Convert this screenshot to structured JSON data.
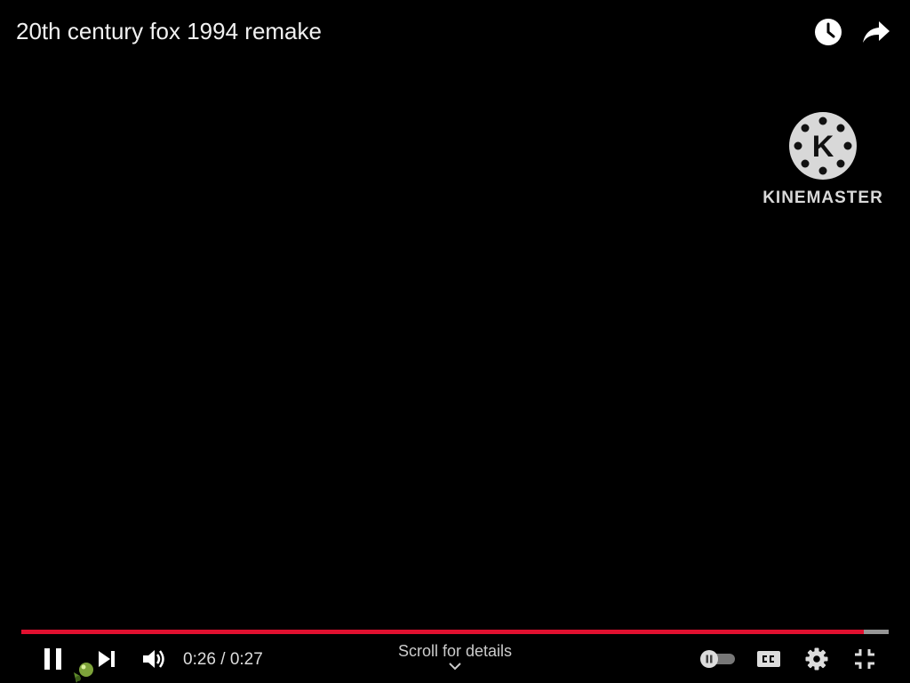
{
  "video": {
    "title": "20th century fox 1994 remake",
    "current_time": "0:26",
    "duration": "0:27",
    "time_separator": " / ",
    "progress_fraction": 0.971
  },
  "watermark": {
    "text": "KINEMASTER",
    "logo_letter": "K"
  },
  "hint": {
    "scroll": "Scroll for details"
  },
  "icons": {
    "watch_later": "clock-icon",
    "share": "share-arrow-icon",
    "play_pause": "pause-icon",
    "next": "next-icon",
    "volume": "volume-icon",
    "autoplay": "autoplay-toggle-icon",
    "captions": "cc-icon",
    "settings": "gear-icon",
    "fullscreen": "exit-fullscreen-icon"
  },
  "colors": {
    "progress": "#e0102f",
    "background": "#000000"
  }
}
